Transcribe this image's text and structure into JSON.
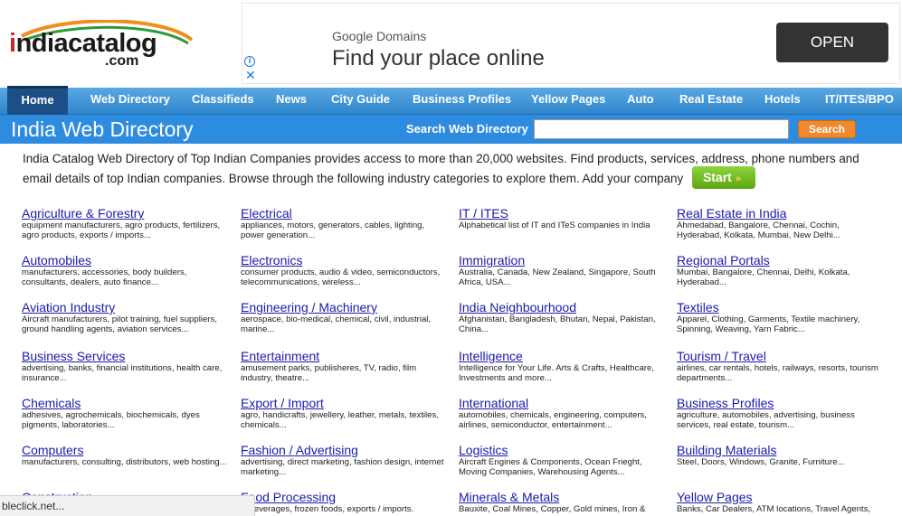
{
  "logo": {
    "main_first": "i",
    "main_rest": "ndiacatalog",
    "sub": ".com"
  },
  "ad": {
    "sponsor": "Google Domains",
    "headline": "Find your place online",
    "cta": "OPEN",
    "info_icon": "i",
    "close_icon": "✕"
  },
  "nav": {
    "home": "Home",
    "items": [
      "Web Directory",
      "Classifieds",
      "News",
      "City Guide",
      "Business Profiles",
      "Yellow Pages",
      "Auto",
      "Real Estate",
      "Hotels",
      "IT/ITES/BPO"
    ]
  },
  "titlebar": {
    "title": "India Web Directory",
    "search_label": "Search Web Directory",
    "search_value": "",
    "search_button": "Search"
  },
  "intro": {
    "text": "India Catalog Web Directory of Top Indian Companies provides access to more than 20,000 websites. Find products, services, address, phone numbers and email details of top Indian companies. Browse through the following industry categories to explore them. Add your company",
    "start_label": "Start",
    "start_arrow": "»"
  },
  "categories": [
    {
      "title": "Agriculture & Forestry",
      "desc": "equipment manufacturers, agro products, fertilizers, agro products, exports / imports..."
    },
    {
      "title": "Electrical",
      "desc": "appliances, motors, generators, cables, lighting, power generation..."
    },
    {
      "title": "IT / ITES",
      "desc": "Alphabetical list of IT and ITeS companies in India"
    },
    {
      "title": "Real Estate in India",
      "desc": "Ahmedabad, Bangalore, Chennai, Cochin, Hyderabad, Kolkata, Mumbai, New Delhi..."
    },
    {
      "title": "Automobiles",
      "desc": "manufacturers, accessories, body builders, consultants, dealers, auto finance..."
    },
    {
      "title": "Electronics",
      "desc": "consumer products, audio & video, semiconductors, telecommunications, wireless..."
    },
    {
      "title": "Immigration",
      "desc": "Australia, Canada, New Zealand, Singapore, South Africa, USA..."
    },
    {
      "title": "Regional Portals",
      "desc": "Mumbai, Bangalore, Chennai, Delhi, Kolkata, Hyderabad..."
    },
    {
      "title": "Aviation Industry",
      "desc": "Aircraft manufacturers, pilot training, fuel suppliers, ground handling agents, aviation services..."
    },
    {
      "title": "Engineering / Machinery",
      "desc": "aerospace, bio-medical, chemical, civil, industrial, marine..."
    },
    {
      "title": "India Neighbourhood",
      "desc": "Afghanistan, Bangladesh, Bhutan, Nepal, Pakistan, China..."
    },
    {
      "title": "Textiles",
      "desc": "Apparel, Clothing, Garments, Textile machinery, Spinning, Weaving, Yarn Fabric..."
    },
    {
      "title": "Business Services",
      "desc": "advertising, banks, financial institutions, health care, insurance..."
    },
    {
      "title": "Entertainment",
      "desc": "amusement parks, publisheres, TV, radio, film industry, theatre..."
    },
    {
      "title": "Intelligence",
      "desc": "Intelligence for Your Life. Arts & Crafts, Healthcare, Investments and more..."
    },
    {
      "title": "Tourism / Travel",
      "desc": "airlines, car rentals, hotels, railways, resorts, tourism departments..."
    },
    {
      "title": "Chemicals",
      "desc": "adhesives, agrochemicals, biochemicals, dyes pigments, laboratories..."
    },
    {
      "title": "Export / Import",
      "desc": "agro, handicrafts, jewellery, leather, metals, textiles, chemicals..."
    },
    {
      "title": "International",
      "desc": "automobiles, chemicals, engineering, computers, airlines, semiconductor, entertainment..."
    },
    {
      "title": "Business Profiles",
      "desc": "agriculture, automobiles, advertising, business services, real estate, tourism..."
    },
    {
      "title": "Computers",
      "desc": "manufacturers, consulting, distributors, web hosting..."
    },
    {
      "title": "Fashion / Advertising",
      "desc": "advertising, direct marketing, fashion design, internet marketing..."
    },
    {
      "title": "Logistics",
      "desc": "Aircraft Engines & Components, Ocean Frieght, Moving Companies, Warehousing Agents..."
    },
    {
      "title": "Building Materials",
      "desc": "Steel, Doors, Windows, Granite, Furniture..."
    },
    {
      "title": "Construction",
      "desc": ""
    },
    {
      "title": "Food Processing",
      "desc": "y, beverages, frozen foods, exports / imports."
    },
    {
      "title": "Minerals & Metals",
      "desc": "Bauxite, Coal Mines, Copper, Gold mines, Iron &"
    },
    {
      "title": "Yellow Pages",
      "desc": "Banks, Car Dealers, ATM locations, Travel Agents,"
    }
  ],
  "statusbar": {
    "text": "bleclick.net..."
  },
  "colors": {
    "nav_bg": "#3b94d6",
    "titlebar_bg": "#2e8ce0",
    "link": "#1a1ab0",
    "search_btn": "#f0892b",
    "start_btn": "#6cb82a"
  }
}
